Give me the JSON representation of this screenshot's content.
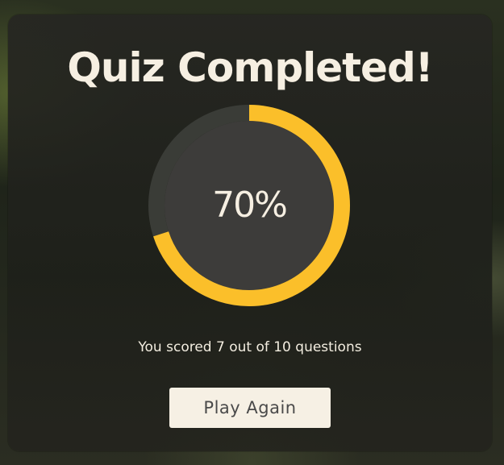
{
  "title": "Quiz Completed!",
  "progress": {
    "percent_label": "70%",
    "percent_value": 70,
    "track_color": "#3a3c37",
    "inner_color": "#3d3c3a",
    "fill_color": "#fbbf2a"
  },
  "score_text": "You scored 7 out of 10 questions",
  "play_again_label": "Play Again"
}
